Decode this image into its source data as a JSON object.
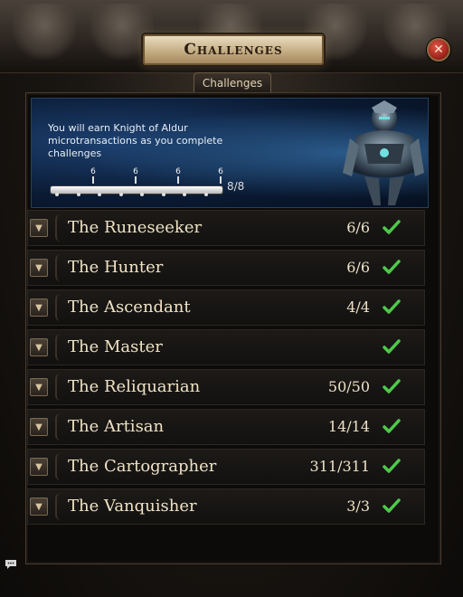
{
  "header": {
    "title": "Challenges",
    "close_icon": "close-icon"
  },
  "tabs": [
    {
      "label": "Challenges",
      "active": true
    }
  ],
  "banner": {
    "text": "You will earn Knight of Aldur microtransactions as you complete challenges",
    "progress_label": "8/8",
    "progress_fraction": 1.0,
    "milestones": [
      "6",
      "6",
      "6",
      "6"
    ]
  },
  "challenges": [
    {
      "name": "The Runeseeker",
      "count": "6/6",
      "completed": true
    },
    {
      "name": "The Hunter",
      "count": "6/6",
      "completed": true
    },
    {
      "name": "The Ascendant",
      "count": "4/4",
      "completed": true
    },
    {
      "name": "The Master",
      "count": "",
      "completed": true
    },
    {
      "name": "The Reliquarian",
      "count": "50/50",
      "completed": true
    },
    {
      "name": "The Artisan",
      "count": "14/14",
      "completed": true
    },
    {
      "name": "The Cartographer",
      "count": "311/311",
      "completed": true
    },
    {
      "name": "The Vanquisher",
      "count": "3/3",
      "completed": true
    }
  ],
  "colors": {
    "accent_gold": "#c9b28a",
    "check_green": "#4ec94a",
    "text_light": "#efe3c6"
  }
}
